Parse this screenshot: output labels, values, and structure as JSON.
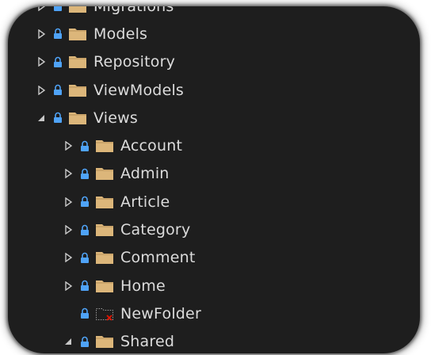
{
  "tree": {
    "top_partial_label": "Migrations",
    "items": [
      {
        "label": "Models",
        "state": "collapsed",
        "level": 0
      },
      {
        "label": "Repository",
        "state": "collapsed",
        "level": 0
      },
      {
        "label": "ViewModels",
        "state": "collapsed",
        "level": 0
      },
      {
        "label": "Views",
        "state": "expanded",
        "level": 0
      },
      {
        "label": "Account",
        "state": "collapsed",
        "level": 1
      },
      {
        "label": "Admin",
        "state": "collapsed",
        "level": 1
      },
      {
        "label": "Article",
        "state": "collapsed",
        "level": 1
      },
      {
        "label": "Category",
        "state": "collapsed",
        "level": 1
      },
      {
        "label": "Comment",
        "state": "collapsed",
        "level": 1
      },
      {
        "label": "Home",
        "state": "collapsed",
        "level": 1
      },
      {
        "label": "NewFolder",
        "state": "none",
        "level": 1,
        "excluded": true
      },
      {
        "label": "Shared",
        "state": "expanded",
        "level": 1
      }
    ]
  },
  "icons": {
    "expander_collapsed": "triangle-right-icon",
    "expander_expanded": "triangle-down-icon",
    "lock": "padlock-icon",
    "folder": "folder-icon",
    "excluded_folder": "excluded-folder-icon"
  },
  "colors": {
    "background": "#1e1e1e",
    "text": "#dcdcdc",
    "lock": "#4fa3f7",
    "folder": "#dcb67a",
    "folder_dark": "#b8935a",
    "excluded_x": "#e51400"
  }
}
